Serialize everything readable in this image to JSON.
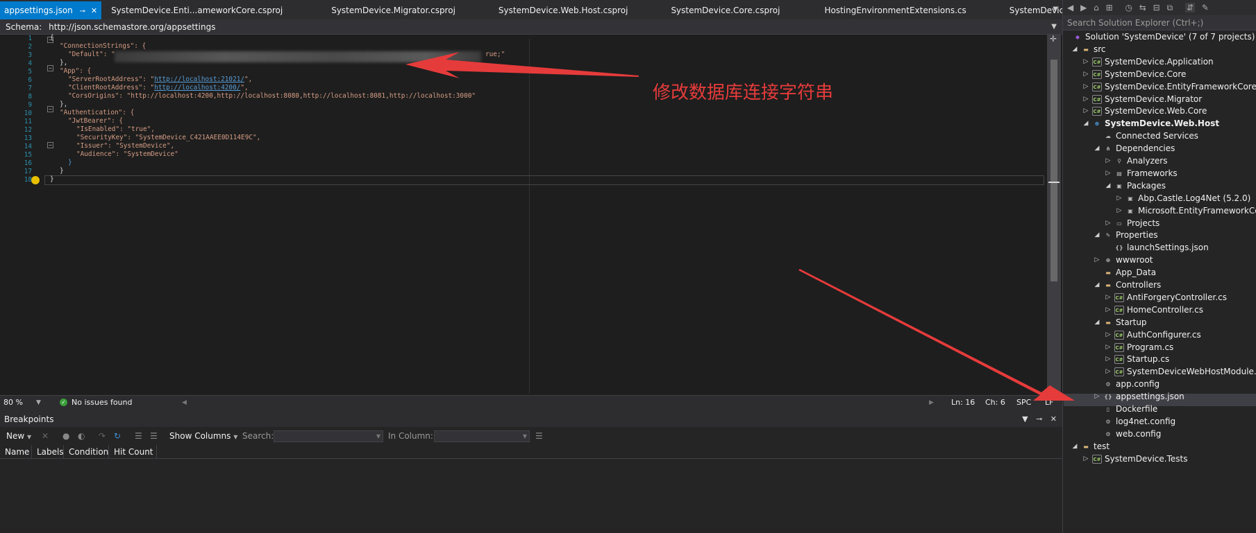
{
  "tabs": [
    {
      "label": "appsettings.json",
      "active": true
    },
    {
      "label": "SystemDevice.Enti...ameworkCore.csproj"
    },
    {
      "label": "SystemDevice.Migrator.csproj"
    },
    {
      "label": "SystemDevice.Web.Host.csproj"
    },
    {
      "label": "SystemDevice.Core.csproj"
    },
    {
      "label": "HostingEnvironmentExtensions.cs"
    },
    {
      "label": "SystemDevice.Web.Core.csproj"
    }
  ],
  "schema": {
    "label": "Schema:",
    "value": "http://json.schemastore.org/appsettings"
  },
  "line_numbers": [
    "1",
    "2",
    "3",
    "4",
    "5",
    "6",
    "7",
    "8",
    "9",
    "10",
    "11",
    "12",
    "13",
    "14",
    "15",
    "16",
    "17",
    "18"
  ],
  "code": {
    "l1": "{",
    "l2": "\"ConnectionStrings\": {",
    "l3a": "\"Default\": \"",
    "l3b": "rue;\"",
    "l4": "},",
    "l5": "\"App\": {",
    "l6a": "\"ServerRootAddress\": \"",
    "l6u": "http://localhost:21021/",
    "l6b": "\",",
    "l7a": "\"ClientRootAddress\": \"",
    "l7u": "http://localhost:4200/",
    "l7b": "\",",
    "l8": "\"CorsOrigins\": \"http://localhost:4200,http://localhost:8080,http://localhost:8081,http://localhost:3000\"",
    "l9": "},",
    "l10": "\"Authentication\": {",
    "l11": "\"JwtBearer\": {",
    "l12": "\"IsEnabled\": \"true\",",
    "l13": "\"SecurityKey\": \"SystemDevice_C421AAEE0D114E9C\",",
    "l14": "\"Issuer\": \"SystemDevice\",",
    "l15": "\"Audience\": \"SystemDevice\"",
    "l16": "}",
    "l17": "}",
    "l18": "}"
  },
  "status": {
    "zoom": "80 %",
    "issues": "No issues found",
    "ln": "Ln: 16",
    "ch": "Ch: 6",
    "spc": "SPC",
    "lf": "LF"
  },
  "breakpoints": {
    "title": "Breakpoints",
    "new": "New",
    "show_columns": "Show Columns",
    "search": "Search:",
    "in_column": "In Column:",
    "columns": [
      "Name",
      "Labels",
      "Condition",
      "Hit Count"
    ]
  },
  "solution_explorer": {
    "search_placeholder": "Search Solution Explorer (Ctrl+;)",
    "items": [
      {
        "label": "Solution 'SystemDevice' (7 of 7 projects)"
      },
      {
        "label": "src"
      },
      {
        "label": "SystemDevice.Application"
      },
      {
        "label": "SystemDevice.Core"
      },
      {
        "label": "SystemDevice.EntityFrameworkCore"
      },
      {
        "label": "SystemDevice.Migrator"
      },
      {
        "label": "SystemDevice.Web.Core"
      },
      {
        "label": "SystemDevice.Web.Host"
      },
      {
        "label": "Connected Services"
      },
      {
        "label": "Dependencies"
      },
      {
        "label": "Analyzers"
      },
      {
        "label": "Frameworks"
      },
      {
        "label": "Packages"
      },
      {
        "label": "Abp.Castle.Log4Net (5.2.0)"
      },
      {
        "label": "Microsoft.EntityFrameworkCo"
      },
      {
        "label": "Projects"
      },
      {
        "label": "Properties"
      },
      {
        "label": "launchSettings.json"
      },
      {
        "label": "wwwroot"
      },
      {
        "label": "App_Data"
      },
      {
        "label": "Controllers"
      },
      {
        "label": "AntiForgeryController.cs"
      },
      {
        "label": "HomeController.cs"
      },
      {
        "label": "Startup"
      },
      {
        "label": "AuthConfigurer.cs"
      },
      {
        "label": "Program.cs"
      },
      {
        "label": "Startup.cs"
      },
      {
        "label": "SystemDeviceWebHostModule.c"
      },
      {
        "label": "app.config"
      },
      {
        "label": "appsettings.json"
      },
      {
        "label": "Dockerfile"
      },
      {
        "label": "log4net.config"
      },
      {
        "label": "web.config"
      },
      {
        "label": "test"
      },
      {
        "label": "SystemDevice.Tests"
      }
    ]
  },
  "annotation": {
    "text": "修改数据库连接字符串",
    "color": "#e63b3b"
  },
  "colors": {
    "accent": "#007acc",
    "editor_bg": "#1e1e1e",
    "panel_bg": "#252526"
  }
}
